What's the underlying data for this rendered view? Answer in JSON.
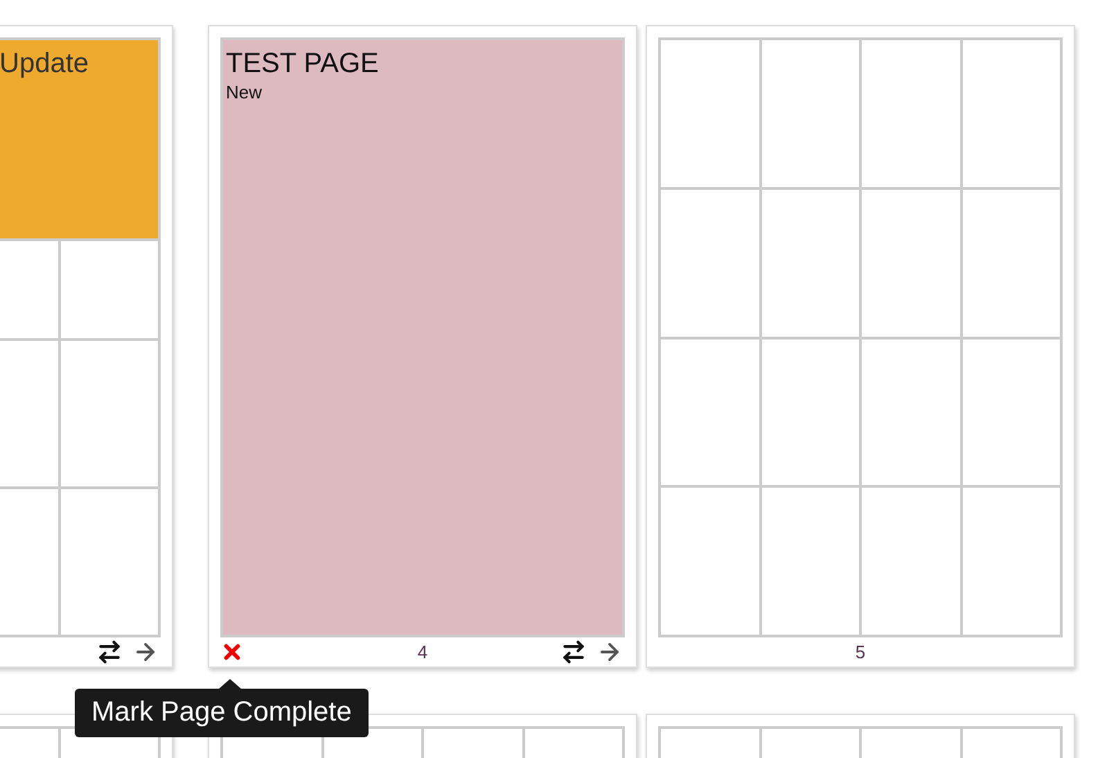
{
  "rows": [
    {
      "pages": [
        {
          "kind": "partial",
          "title": "Update",
          "color": "#eeaa2e",
          "actions": true
        },
        {
          "kind": "filled",
          "title": "TEST PAGE",
          "subtitle": "New",
          "color": "#ddb9c0",
          "number": "4",
          "actions": true,
          "complete": false
        },
        {
          "kind": "blank",
          "number": "5",
          "actions": false
        }
      ]
    },
    {
      "pages": [
        {
          "kind": "blank"
        },
        {
          "kind": "blank"
        },
        {
          "kind": "blank"
        }
      ]
    }
  ],
  "tooltip": {
    "text": "Mark Page Complete"
  }
}
